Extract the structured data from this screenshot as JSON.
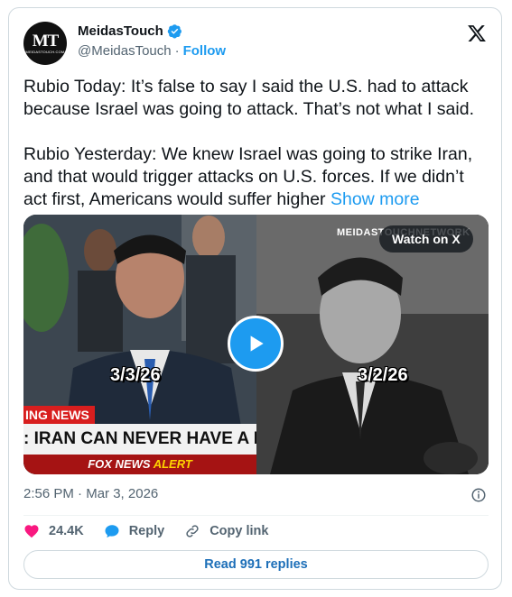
{
  "author": {
    "avatar_text": "MT",
    "avatar_subtext": "MEIDASTOUCH.COM",
    "name": "MeidasTouch",
    "handle": "@MeidasTouch",
    "separator": "·",
    "follow_label": "Follow",
    "verified": true
  },
  "post": {
    "paragraph1": "Rubio Today: It’s false to say I said the U.S. had to attack because Israel was going to attack. That’s not what I said.",
    "paragraph2": "Rubio Yesterday: We knew Israel was going to strike Iran, and that would trigger attacks on U.S. forces. If we didn’t act first, Americans would suffer higher",
    "show_more_label": "Show more"
  },
  "media": {
    "left_date": "3/3/26",
    "right_date": "3/2/26",
    "network_watermark": "MEIDASTOUCHNETWORK",
    "watch_label": "Watch on X",
    "chyron_tag": "ING NEWS",
    "chyron_text": ": IRAN CAN NEVER HAVE A NUCLEA",
    "chyron_brand": "FOX NEWS",
    "chyron_alert": "ALERT",
    "play_icon": "play-icon"
  },
  "meta": {
    "time": "2:56 PM",
    "separator": "·",
    "date": "Mar 3, 2026"
  },
  "actions": {
    "like_count": "24.4K",
    "reply_label": "Reply",
    "copy_link_label": "Copy link",
    "read_replies_label": "Read 991 replies"
  },
  "colors": {
    "accent": "#1d9bf0",
    "like": "#f91880",
    "text": "#0f1419",
    "muted": "#536471"
  }
}
